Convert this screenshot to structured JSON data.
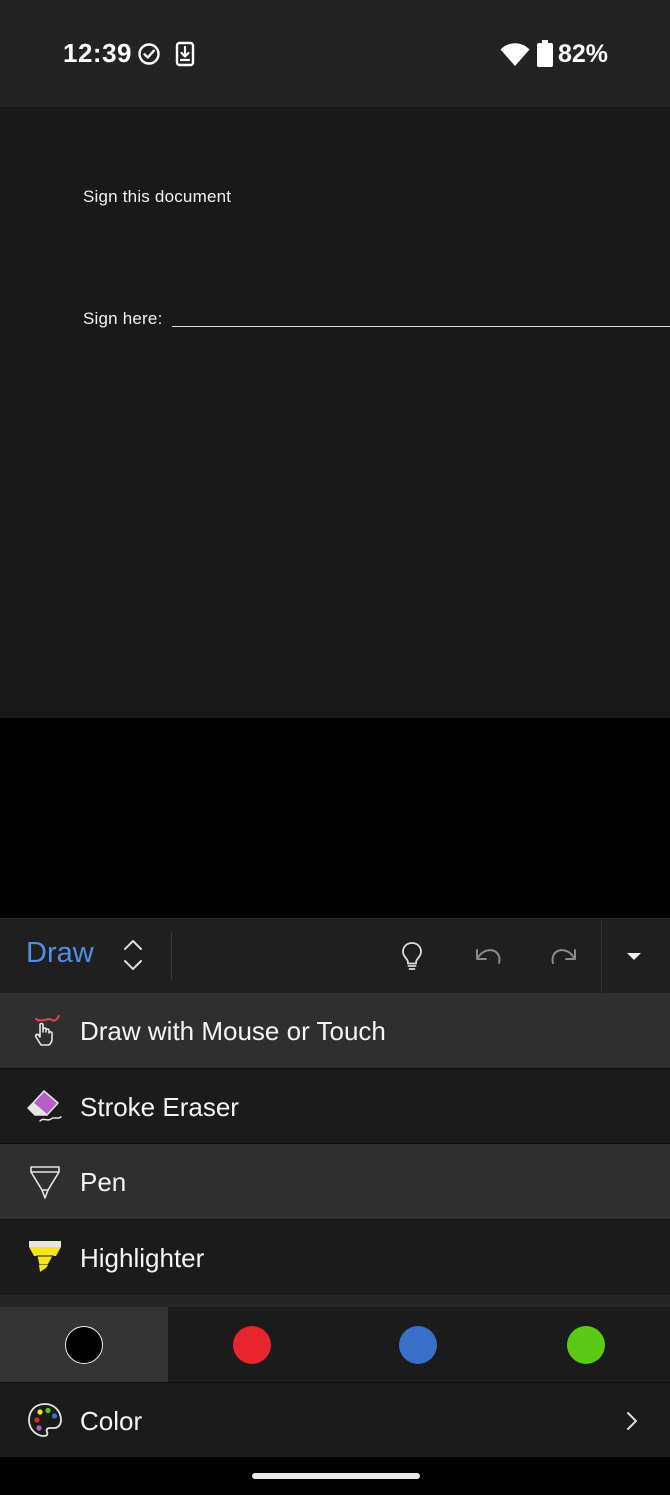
{
  "status_bar": {
    "time": "12:39",
    "battery_percent": "82%",
    "icons": [
      "check-circle-icon",
      "download-icon",
      "wifi-icon",
      "battery-icon"
    ]
  },
  "document": {
    "title_text": "Sign this document",
    "sign_label": "Sign here:"
  },
  "ribbon": {
    "tab_label": "Draw",
    "icons": [
      "switch-tabs-icon",
      "lightbulb-icon",
      "undo-icon",
      "redo-icon",
      "expand-caret-icon"
    ]
  },
  "draw_menu": {
    "items": [
      {
        "label": "Draw with Mouse or Touch",
        "icon": "draw-touch-icon"
      },
      {
        "label": "Stroke Eraser",
        "icon": "eraser-icon"
      },
      {
        "label": "Pen",
        "icon": "pen-icon"
      },
      {
        "label": "Highlighter",
        "icon": "highlighter-icon"
      }
    ]
  },
  "palette": {
    "swatches": [
      {
        "name": "black",
        "hex": "#000000",
        "selected": true
      },
      {
        "name": "red",
        "hex": "#e8242c",
        "selected": false
      },
      {
        "name": "blue",
        "hex": "#3a6fc9",
        "selected": false
      },
      {
        "name": "green",
        "hex": "#5acb14",
        "selected": false
      }
    ],
    "color_label": "Color"
  },
  "colors": {
    "accent": "#4f8fe6",
    "highlighter_yellow": "#f5e61c",
    "eraser_purple": "#b45ec8"
  }
}
